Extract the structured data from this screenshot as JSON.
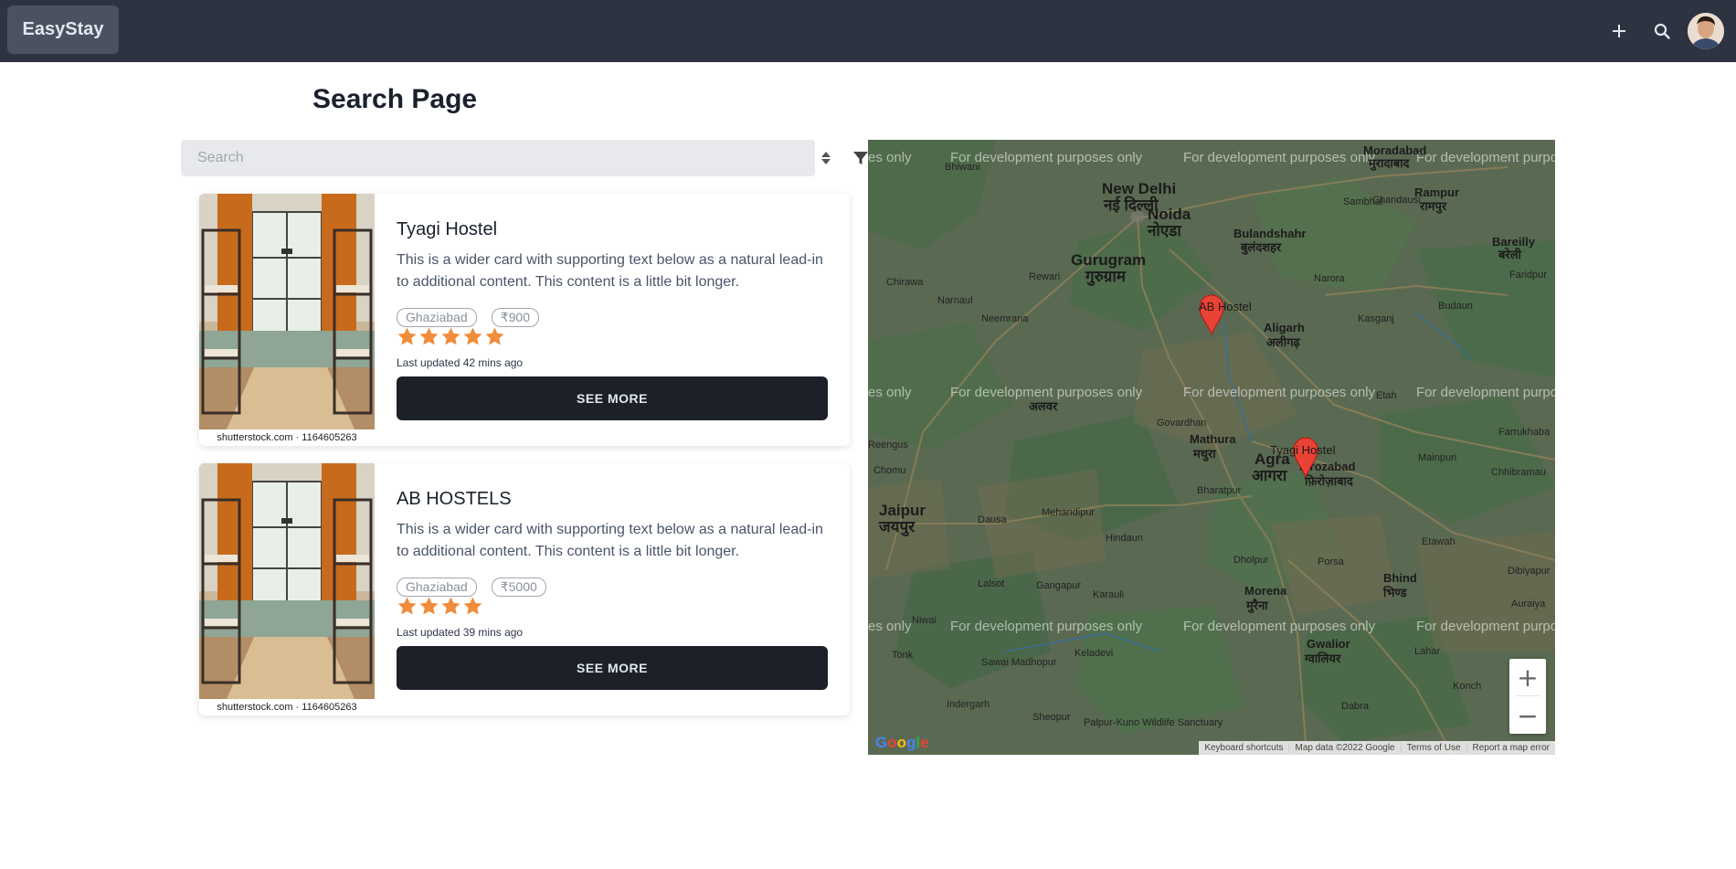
{
  "navbar": {
    "brand": "EasyStay",
    "icons": [
      "plus-icon",
      "search-icon"
    ]
  },
  "page": {
    "title": "Search Page"
  },
  "search": {
    "placeholder": "Search",
    "value": ""
  },
  "cards": [
    {
      "title": "Tyagi Hostel",
      "text": "This is a wider card with supporting text below as a natural lead-in to additional content. This content is a little bit longer.",
      "city": "Ghaziabad",
      "price": "₹900",
      "rating": 5,
      "updated": "Last updated 42 mins ago",
      "button": "SEE MORE",
      "image_caption": "shutterstock.com · 1164605263"
    },
    {
      "title": "AB HOSTELS",
      "text": "This is a wider card with supporting text below as a natural lead-in to additional content. This content is a little bit longer.",
      "city": "Ghaziabad",
      "price": "₹5000",
      "rating": 4,
      "updated": "Last updated 39 mins ago",
      "button": "SEE MORE",
      "image_caption": "shutterstock.com · 1164605263"
    }
  ],
  "map": {
    "watermark": "For development purposes only",
    "watermark_partial_left": "es only",
    "watermark_partial_right": "For development purpo",
    "markers": [
      "AB Hostel",
      "Tyagi Hostel"
    ],
    "cities": {
      "new_delhi": "New Delhi",
      "new_delhi_hi": "नई दिल्ली",
      "noida": "Noida",
      "noida_hi": "नोएडा",
      "gurugram": "Gurugram",
      "gurugram_hi": "गुरुग्राम",
      "bulandshahr": "Bulandshahr",
      "bulandshahr_hi": "बुलंदशहर",
      "moradabad": "Moradabad",
      "moradabad_hi": "मुरादाबाद",
      "rampur": "Rampur",
      "rampur_hi": "रामपुर",
      "bareilly": "Bareilly",
      "bareilly_hi": "बरेली",
      "aligarh": "Aligarh",
      "aligarh_hi": "अलीगढ़",
      "agra": "Agra",
      "agra_hi": "आगरा",
      "firozabad": "Firozabad",
      "firozabad_hi": "फ़िरोज़ाबाद",
      "mathura": "Mathura",
      "mathura_hi": "मथुरा",
      "jaipur": "Jaipur",
      "jaipur_hi": "जयपुर",
      "alwar_hi": "अलवर",
      "morena": "Morena",
      "morena_hi": "मुरैना",
      "gwalior": "Gwalior",
      "gwalior_hi": "ग्वालियर",
      "bhind": "Bhind",
      "bhind_hi": "भिण्ड",
      "etah": "Etah",
      "rewari": "Rewari",
      "kasganj": "Kasganj",
      "sambhal": "Sambhal",
      "budaun": "Budaun",
      "mainpuri": "Mainpuri",
      "etawah": "Etawah",
      "dholpur": "Dholpur",
      "bharatpur": "Bharatpur",
      "dausa": "Dausa",
      "karauli": "Karauli",
      "sheopur": "Sheopur",
      "palpur": "Palpur-Kuno\nWildlife\nSanctuary",
      "narora": "Narora",
      "chandausi": "Chandausi",
      "neemrana": "Neemrana",
      "chirawa": "Chirawa",
      "namaul": "Narnaul",
      "govardhan": "Govardhan",
      "mehandipur": "Mehandipur",
      "hindaun": "Hindaun",
      "lalsot": "Lalsot",
      "gangapur": "Gangapur",
      "kelade": "Keladevi",
      "sawai": "Sawai\nMadhopur",
      "tonk": "Tonk",
      "porsa": "Porsa",
      "dabra": "Dabra",
      "farrukhabad": "Farrukhaba",
      "chhibramau": "Chhibramau",
      "auraiya": "Auraiya",
      "lahar": "Lahar",
      "konch": "Konch",
      "dibiyapur": "Dibiyapur",
      "faridpur": "Faridpur",
      "bhiwani": "Bhiwani",
      "chomu": "Chomu",
      "reengus": "Reengus",
      "niwai": "Niwai",
      "indergarh": "Indergarh"
    },
    "zoom_in": "+",
    "zoom_out": "−",
    "google": "Google",
    "attribution": [
      "Keyboard shortcuts",
      "Map data ©2022 Google",
      "Terms of Use",
      "Report a map error"
    ]
  },
  "colors": {
    "navbar": "#2d3340",
    "brand_bg": "#4a5160",
    "button": "#1c2028",
    "star": "#f08c3a",
    "marker": "#ea4335",
    "map_base": "#5d6b55"
  }
}
